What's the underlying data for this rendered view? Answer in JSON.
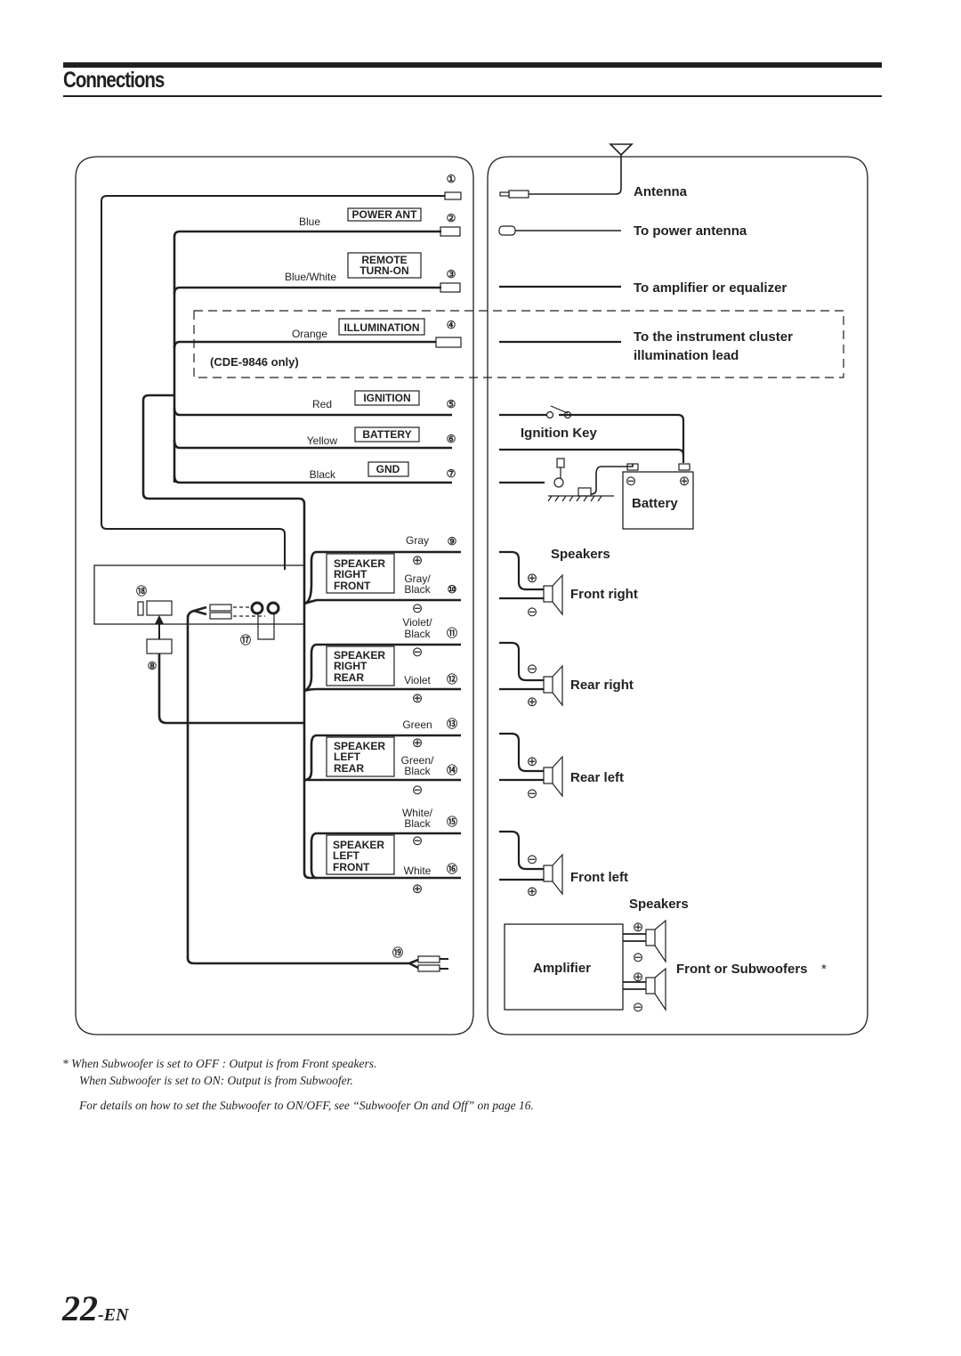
{
  "header": {
    "title": "Connections"
  },
  "head_unit_leads": [
    {
      "num": "①",
      "color": "",
      "label": "",
      "destination": "Antenna"
    },
    {
      "num": "②",
      "color": "Blue",
      "label": "POWER ANT",
      "destination": "To power antenna"
    },
    {
      "num": "③",
      "color": "Blue/White",
      "label_lines": [
        "REMOTE",
        "TURN-ON"
      ],
      "destination": "To amplifier or equalizer"
    },
    {
      "num": "④",
      "color": "Orange",
      "label": "ILLUMINATION",
      "destination_lines": [
        "To the instrument cluster",
        "illumination lead"
      ],
      "note": "(CDE-9846 only)"
    },
    {
      "num": "⑤",
      "color": "Red",
      "label": "IGNITION",
      "destination": "Ignition Key"
    },
    {
      "num": "⑥",
      "color": "Yellow",
      "label": "BATTERY",
      "destination": "Battery"
    },
    {
      "num": "⑦",
      "color": "Black",
      "label": "GND",
      "destination": ""
    }
  ],
  "speaker_groups": [
    {
      "label_lines": [
        "SPEAKER",
        "RIGHT",
        "FRONT"
      ],
      "wires": [
        {
          "num": "⑨",
          "color_lines": [
            "Gray"
          ],
          "polarity": "+"
        },
        {
          "num": "⑩",
          "color_lines": [
            "Gray/",
            "Black"
          ],
          "polarity": "-"
        }
      ],
      "destination": "Front right",
      "dest_polarity": [
        "+",
        "-"
      ]
    },
    {
      "label_lines": [
        "SPEAKER",
        "RIGHT",
        "REAR"
      ],
      "wires": [
        {
          "num": "⑪",
          "color_lines": [
            "Violet/",
            "Black"
          ],
          "polarity": "-"
        },
        {
          "num": "⑫",
          "color_lines": [
            "Violet"
          ],
          "polarity": "+"
        }
      ],
      "destination": "Rear right",
      "dest_polarity": [
        "-",
        "+"
      ]
    },
    {
      "label_lines": [
        "SPEAKER",
        "LEFT",
        "REAR"
      ],
      "wires": [
        {
          "num": "⑬",
          "color_lines": [
            "Green"
          ],
          "polarity": "+"
        },
        {
          "num": "⑭",
          "color_lines": [
            "Green/",
            "Black"
          ],
          "polarity": "-"
        }
      ],
      "destination": "Rear left",
      "dest_polarity": [
        "+",
        "-"
      ]
    },
    {
      "label_lines": [
        "SPEAKER",
        "LEFT",
        "FRONT"
      ],
      "wires": [
        {
          "num": "⑮",
          "color_lines": [
            "White/",
            "Black"
          ],
          "polarity": "-"
        },
        {
          "num": "⑯",
          "color_lines": [
            "White"
          ],
          "polarity": "+"
        }
      ],
      "destination": "Front left",
      "dest_polarity": [
        "-",
        "+"
      ]
    }
  ],
  "other_numbers": {
    "connector_8": "⑧",
    "rca_17": "⑰",
    "connector_18": "⑱",
    "rca_19": "⑲"
  },
  "right_panel": {
    "speakers_heading": "Speakers",
    "speakers_heading_2": "Speakers",
    "battery": "Battery",
    "ignition_key": "Ignition Key",
    "amplifier": "Amplifier",
    "front_or_sub": "Front or Subwoofers",
    "asterisk": "*"
  },
  "symbols": {
    "plus": "⊕",
    "minus": "⊖"
  },
  "footnotes": {
    "line1": "*  When Subwoofer is set to OFF : Output is from Front speakers.",
    "line2": "When Subwoofer is set to ON: Output is from Subwoofer.",
    "line3": "For details on how to  set the Subwoofer to ON/OFF, see “Subwoofer On and Off” on page 16."
  },
  "page": {
    "number": "22",
    "suffix": "-EN"
  }
}
